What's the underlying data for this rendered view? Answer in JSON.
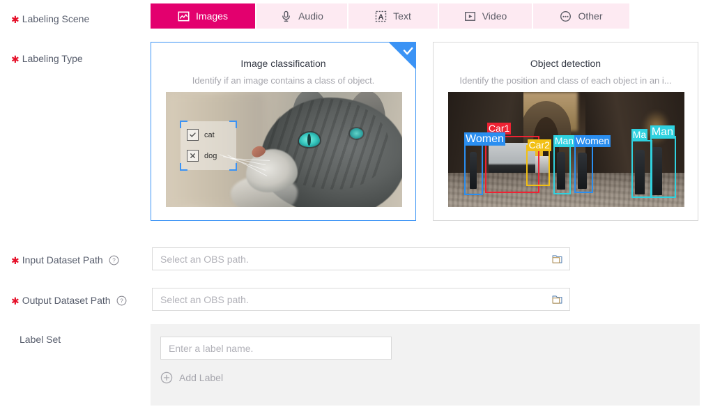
{
  "form": {
    "labeling_scene": {
      "label": "Labeling Scene",
      "required": true
    },
    "labeling_type": {
      "label": "Labeling Type",
      "required": true
    },
    "input_dataset_path": {
      "label": "Input Dataset Path",
      "required": true,
      "help_icon": "question-circle-icon",
      "value": "",
      "placeholder": "Select an OBS path.",
      "browse_icon": "folder-icon"
    },
    "output_dataset_path": {
      "label": "Output Dataset Path",
      "required": true,
      "help_icon": "question-circle-icon",
      "value": "",
      "placeholder": "Select an OBS path.",
      "browse_icon": "folder-icon"
    },
    "label_set": {
      "label": "Label Set",
      "required": false,
      "input_value": "",
      "input_placeholder": "Enter a label name.",
      "add_label_text": "Add Label",
      "add_icon": "plus-circle-icon"
    }
  },
  "scene_tabs": {
    "active_index": 0,
    "items": [
      {
        "label": "Images",
        "icon": "image-icon",
        "active": true
      },
      {
        "label": "Audio",
        "icon": "microphone-icon",
        "active": false
      },
      {
        "label": "Text",
        "icon": "text-a-icon",
        "active": false
      },
      {
        "label": "Video",
        "icon": "video-play-icon",
        "active": false
      },
      {
        "label": "Other",
        "icon": "ellipsis-circle-icon",
        "active": false
      }
    ]
  },
  "type_cards": [
    {
      "title": "Image classification",
      "description": "Identify if an image contains a class of object.",
      "selected": true,
      "check_icon": "check-icon",
      "preview": {
        "kind": "cat-photo",
        "overlay_labels": [
          {
            "name": "cat",
            "state": "checked",
            "mark": "check-icon"
          },
          {
            "name": "dog",
            "state": "excluded",
            "mark": "close-icon"
          }
        ]
      }
    },
    {
      "title": "Object detection",
      "description": "Identify the position and class of each object in an i...",
      "selected": false,
      "preview": {
        "kind": "street-photo",
        "boxes": [
          {
            "label": "Car1",
            "color": "#ef2233"
          },
          {
            "label": "Women",
            "color": "#2a8ef0"
          },
          {
            "label": "Car2",
            "color": "#f2c014"
          },
          {
            "label": "Man",
            "color": "#2fd2e0"
          },
          {
            "label": "Women",
            "color": "#2a8ef0"
          },
          {
            "label": "Ma",
            "color": "#2fd2e0"
          },
          {
            "label": "Man",
            "color": "#2fd2e0"
          }
        ]
      }
    }
  ],
  "colors": {
    "accent_magenta": "#e3006e",
    "tab_inactive_bg": "#fdeaf2",
    "selected_blue": "#3b93f5",
    "required_red": "#e6112a",
    "panel_gray": "#f2f2f2",
    "border_gray": "#d9d9d9",
    "placeholder_gray": "#b1b1b8"
  }
}
